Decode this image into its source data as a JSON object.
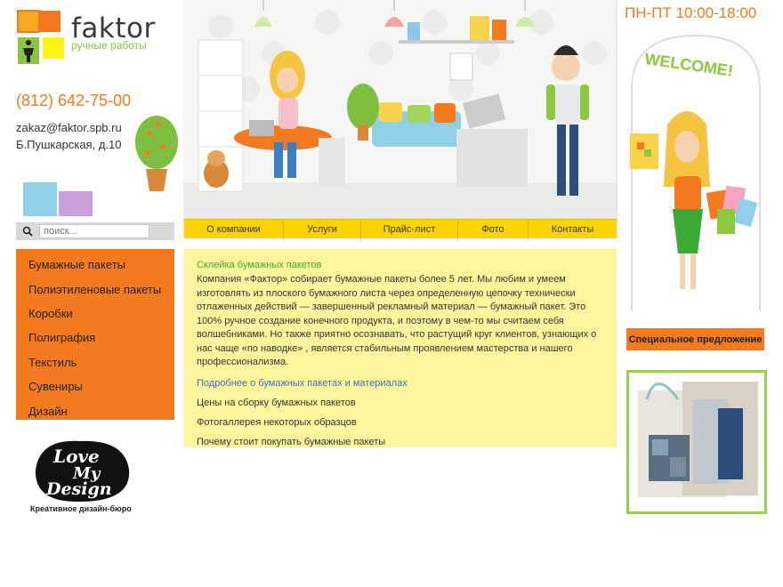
{
  "header": {
    "logo_word": "faktor",
    "logo_tagline": "ручные работы",
    "phone": "(812) 642-75-00",
    "email": "zakaz@faktor.spb.ru",
    "address": "Б.Пушкарская, д.10",
    "hours": "ПН-ПТ 10:00-18:00"
  },
  "hero": {
    "welcome": "WELCOME!"
  },
  "search": {
    "placeholder": "поиск..."
  },
  "topnav": {
    "items": [
      {
        "label": "О компании"
      },
      {
        "label": "Услуги"
      },
      {
        "label": "Прайс-лист"
      },
      {
        "label": "Фото"
      },
      {
        "label": "Контакты"
      }
    ]
  },
  "leftmenu": {
    "items": [
      {
        "label": "Бумажные пакеты"
      },
      {
        "label": "Полиэтиленовые пакеты"
      },
      {
        "label": "Коробки"
      },
      {
        "label": "Полиграфия"
      },
      {
        "label": "Текстиль"
      },
      {
        "label": "Сувениры"
      },
      {
        "label": "Дизайн"
      }
    ]
  },
  "partner": {
    "line1": "Love",
    "line2": "My",
    "line3": "Design",
    "caption": "Креативное дизайн-бюро"
  },
  "content": {
    "title": "Склейка бумажных пакетов",
    "body": "Компания «Фактор» собирает бумажные пакеты более 5 лет. Мы любим и умеем изготовлять из плоского бумажного листа через определенную цепочку технически отлаженных действий — завершенный рекламный материал — бумажный пакет. Это 100% ручное создание конечного продукта, и поэтому в чем-то мы считаем себя волшебниками. Но также приятно осознавать, что растущий круг клиентов, узнающих о нас чаще «по наводке» , является стабильным проявлением мастерства и нашего профессионализма.",
    "more_link": "Подробнее о бумажных пакетах и материалах",
    "links": [
      "Цены на сборку бумажных пакетов",
      "Фотогаллерея некоторых образцов",
      "Почему стоит покупать бумажные пакеты"
    ]
  },
  "special": {
    "label": "Специальное предложение"
  },
  "colors": {
    "accent_orange": "#f47a20",
    "nav_yellow": "#ffd400",
    "content_bg": "#fff59d",
    "logo_green": "#8dc63f"
  }
}
